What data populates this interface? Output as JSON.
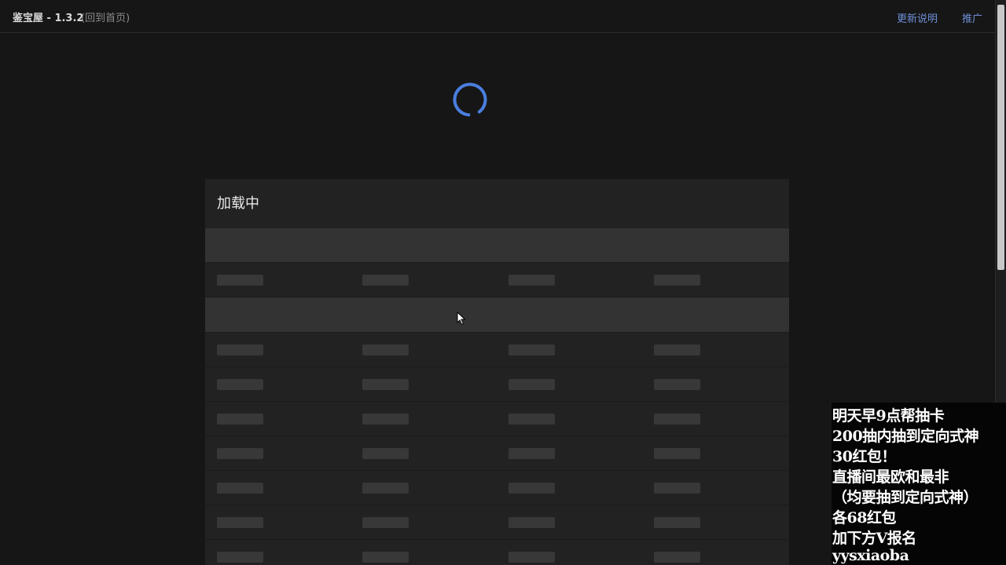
{
  "topbar": {
    "brand": "鉴宝屋 - 1.3.2",
    "home_link": "(回到首页)",
    "nav": [
      {
        "label": "更新说明"
      },
      {
        "label": "推广"
      }
    ]
  },
  "loading": {
    "card_title": "加载中"
  },
  "colors": {
    "accent": "#6f8fd8",
    "spinner": "#4a7ee0",
    "background": "#161616",
    "card": "#222222"
  },
  "overlay": {
    "lines": [
      "明天早9点帮抽卡",
      "200抽内抽到定向式神",
      "30红包！",
      "直播间最欧和最非",
      "（均要抽到定向式神）",
      "各68红包",
      "加下方V报名",
      "yysxiaoba"
    ]
  }
}
